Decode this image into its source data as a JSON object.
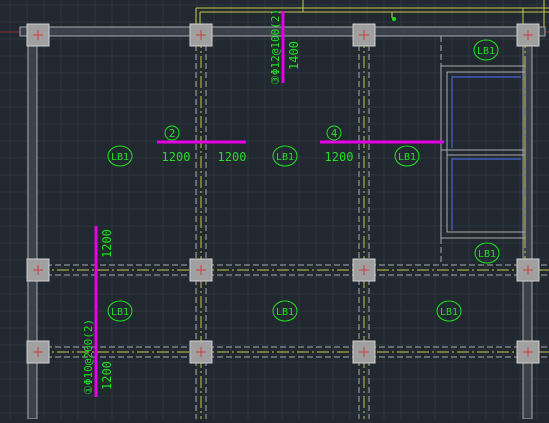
{
  "colors": {
    "background": "#212830",
    "grid": "#2f3843",
    "beam_outline": "#a9a9a9",
    "beam_fill": "#3a414a",
    "beam_centerline": "#c8c84a",
    "rebar": "#e600e6",
    "label": "#1fe01f",
    "column_fill": "#a0a0a0",
    "column_mark": "#d23c3c",
    "opening": "#4664d2"
  },
  "slab_labels": [
    "LB1",
    "LB1",
    "LB1",
    "LB1",
    "LB1",
    "LB1",
    "LB1",
    "LB1",
    "LB1"
  ],
  "rebars": {
    "r2": {
      "number": "2",
      "left_length": "1200",
      "right_length": "1200"
    },
    "r4": {
      "number": "4",
      "left_length": "1200"
    },
    "r3": {
      "spec": "③Φ12@100(2)",
      "length": "1400"
    },
    "r1": {
      "spec": "①Φ10@200(2)",
      "top_length": "1200",
      "bottom_length": "1200"
    }
  }
}
